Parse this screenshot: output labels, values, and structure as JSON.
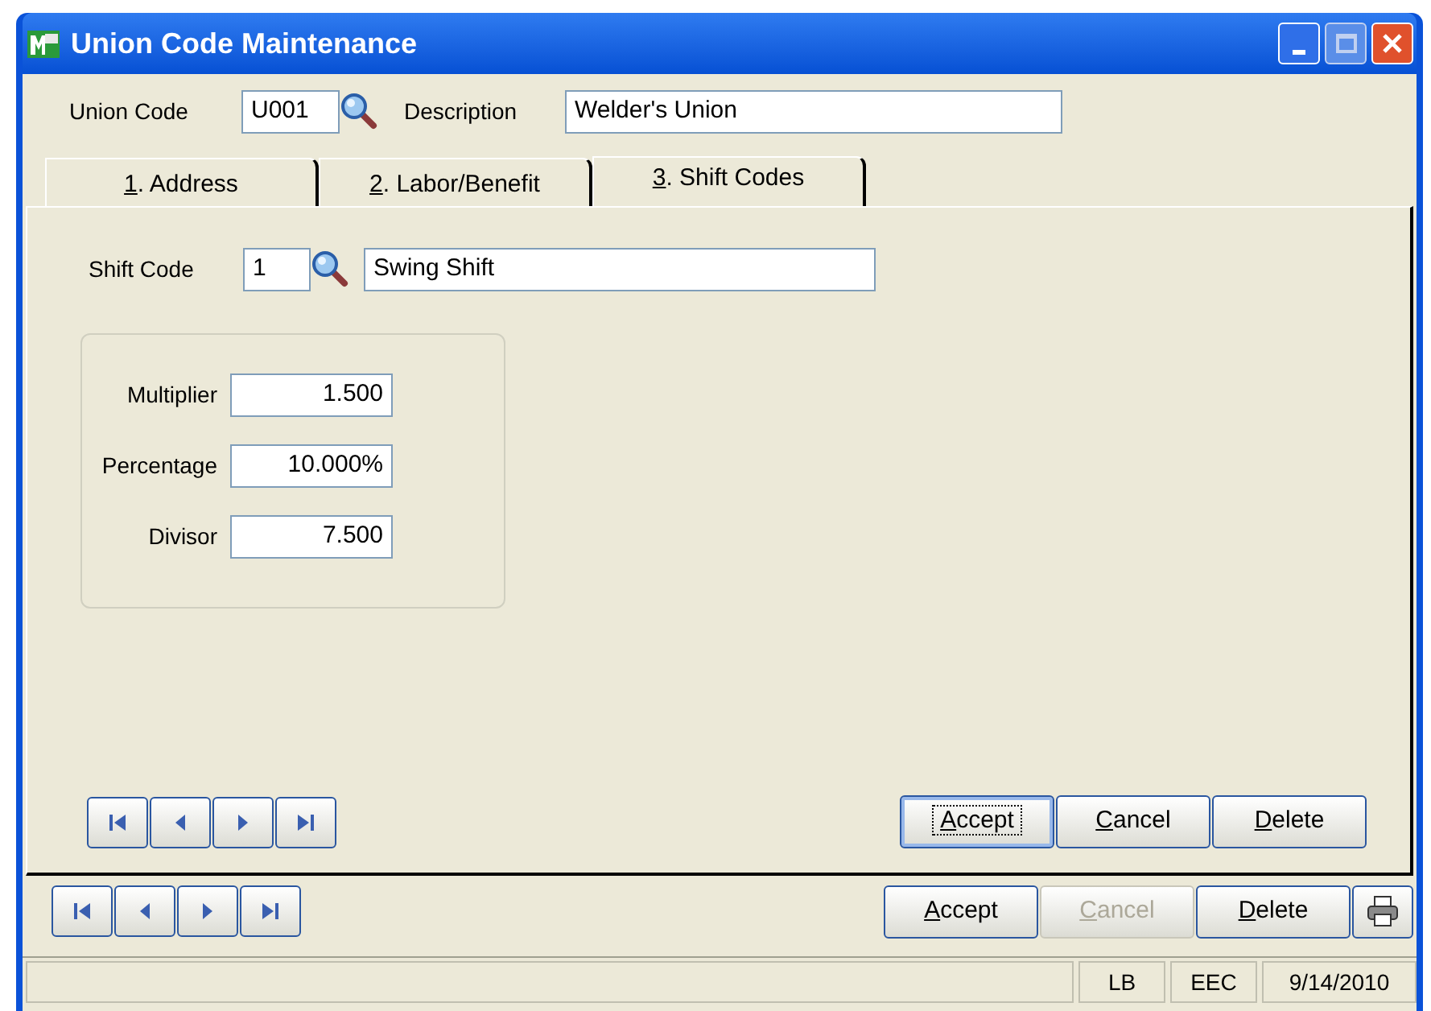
{
  "window": {
    "title": "Union Code Maintenance"
  },
  "header": {
    "union_code_label": "Union Code",
    "union_code": "U001",
    "description_label": "Description",
    "description": "Welder's Union"
  },
  "tabs": [
    {
      "label": "1. Address",
      "selected": false
    },
    {
      "label": "2. Labor/Benefit",
      "selected": false
    },
    {
      "label": "3. Shift Codes",
      "selected": true
    }
  ],
  "shift": {
    "label": "Shift Code",
    "code": "1",
    "description": "Swing Shift",
    "fields": [
      {
        "label": "Multiplier",
        "value": "1.500"
      },
      {
        "label": "Percentage",
        "value": "10.000%"
      },
      {
        "label": "Divisor",
        "value": "7.500"
      }
    ],
    "buttons": [
      {
        "label": "Accept",
        "disabled": false,
        "focused": true
      },
      {
        "label": "Cancel",
        "disabled": false,
        "focused": false
      },
      {
        "label": "Delete",
        "disabled": false,
        "focused": false
      }
    ]
  },
  "buttons": [
    {
      "label": "Accept",
      "disabled": false,
      "focused": false
    },
    {
      "label": "Cancel",
      "disabled": true,
      "focused": false
    },
    {
      "label": "Delete",
      "disabled": false,
      "focused": false
    }
  ],
  "status_bar": {
    "panels": [
      "LB",
      "EEC",
      "9/14/2010"
    ]
  }
}
